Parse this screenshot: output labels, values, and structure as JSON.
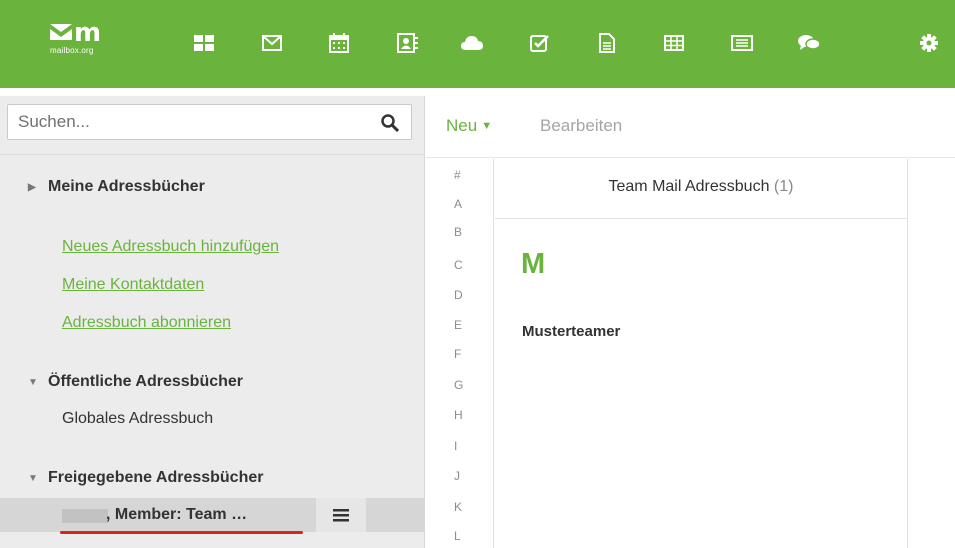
{
  "brand": {
    "name": "mailbox.org"
  },
  "apps": [
    {
      "icon": "portal-grid-icon"
    },
    {
      "icon": "mail-icon"
    },
    {
      "icon": "calendar-icon"
    },
    {
      "icon": "address-book-icon"
    },
    {
      "icon": "cloud-drive-icon"
    },
    {
      "icon": "tasks-icon"
    },
    {
      "icon": "document-icon"
    },
    {
      "icon": "spreadsheet-icon"
    },
    {
      "icon": "presentation-icon"
    },
    {
      "icon": "chat-icon"
    },
    {
      "icon": "settings-gear-icon"
    }
  ],
  "search": {
    "placeholder": "Suchen..."
  },
  "sidebar": {
    "my_books": {
      "label": "Meine Adressbücher"
    },
    "links": [
      "Neues Adressbuch hinzufügen",
      "Meine Kontaktdaten",
      "Adressbuch abonnieren"
    ],
    "public_books": {
      "label": "Öffentliche Adressbücher",
      "items": [
        "Globales Adressbuch"
      ]
    },
    "shared_books": {
      "label": "Freigegebene Adressbücher",
      "selected_label": ", Member: Team …"
    }
  },
  "toolbar": {
    "new_label": "Neu",
    "edit_label": "Bearbeiten"
  },
  "alphabet": [
    "#",
    "A",
    "B",
    "C",
    "D",
    "E",
    "F",
    "G",
    "H",
    "I",
    "J",
    "K",
    "L"
  ],
  "list": {
    "title": "Team Mail Adressbuch",
    "count": "(1)",
    "group_letter": "M",
    "contacts": [
      "Musterteamer"
    ]
  },
  "colors": {
    "accent": "#6ab33d",
    "highlight": "#d9241b"
  }
}
